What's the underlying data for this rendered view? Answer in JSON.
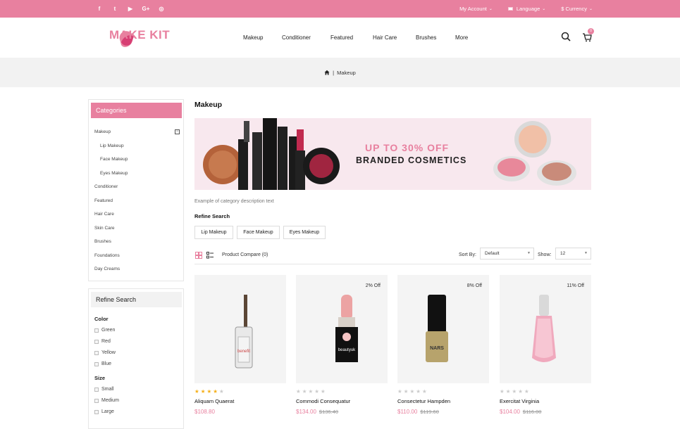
{
  "brand": {
    "name": "MAKE KIT",
    "accent": "#e8809f"
  },
  "topbar": {
    "social": [
      "facebook-icon",
      "twitter-icon",
      "youtube-icon",
      "google-plus-icon",
      "instagram-icon"
    ],
    "social_glyphs": [
      "f",
      "t",
      "▶",
      "G+",
      "◎"
    ],
    "account": "My Account",
    "language": "Language",
    "currency": "$ Currency"
  },
  "nav": {
    "items": [
      "Makeup",
      "Conditioner",
      "Featured",
      "Hair Care",
      "Brushes",
      "More"
    ]
  },
  "cart": {
    "count": "0"
  },
  "breadcrumb": {
    "sep": "|",
    "current": "Makeup"
  },
  "sidebar": {
    "categories_title": "Categories",
    "categories": [
      {
        "label": "Makeup",
        "sub": false
      },
      {
        "label": "Lip Makeup",
        "sub": true
      },
      {
        "label": "Face Makeup",
        "sub": true
      },
      {
        "label": "Eyes Makeup",
        "sub": true
      },
      {
        "label": "Conditioner",
        "sub": false
      },
      {
        "label": "Featured",
        "sub": false
      },
      {
        "label": "Hair Care",
        "sub": false
      },
      {
        "label": "Skin Care",
        "sub": false
      },
      {
        "label": "Brushes",
        "sub": false
      },
      {
        "label": "Foundations",
        "sub": false
      },
      {
        "label": "Day Creams",
        "sub": false
      }
    ],
    "refine_title": "Refine Search",
    "color_title": "Color",
    "colors": [
      "Green",
      "Red",
      "Yellow",
      "Blue"
    ],
    "size_title": "Size",
    "sizes": [
      "Small",
      "Medium",
      "Large"
    ]
  },
  "main": {
    "title": "Makeup",
    "banner_line1": "UP TO 30% OFF",
    "banner_line2": "BRANDED COSMETICS",
    "description": "Example of category description text",
    "refine_title": "Refine Search",
    "refine_chips": [
      "Lip Makeup",
      "Face Makeup",
      "Eyes Makeup"
    ],
    "compare": "Product Compare (0)",
    "sort_label": "Sort By:",
    "sort_value": "Default",
    "show_label": "Show:",
    "show_value": "12"
  },
  "products": [
    {
      "name": "Aliquam Quaerat",
      "price": "$108.80",
      "old_price": "",
      "off": "",
      "rating": 4
    },
    {
      "name": "Commodi Consequatur",
      "price": "$134.00",
      "old_price": "$136.40",
      "off": "2% Off",
      "rating": 0
    },
    {
      "name": "Consectetur Hampden",
      "price": "$110.00",
      "old_price": "$119.60",
      "off": "8% Off",
      "rating": 0
    },
    {
      "name": "Exercitat Virginia",
      "price": "$104.00",
      "old_price": "$116.00",
      "off": "11% Off",
      "rating": 0
    }
  ]
}
